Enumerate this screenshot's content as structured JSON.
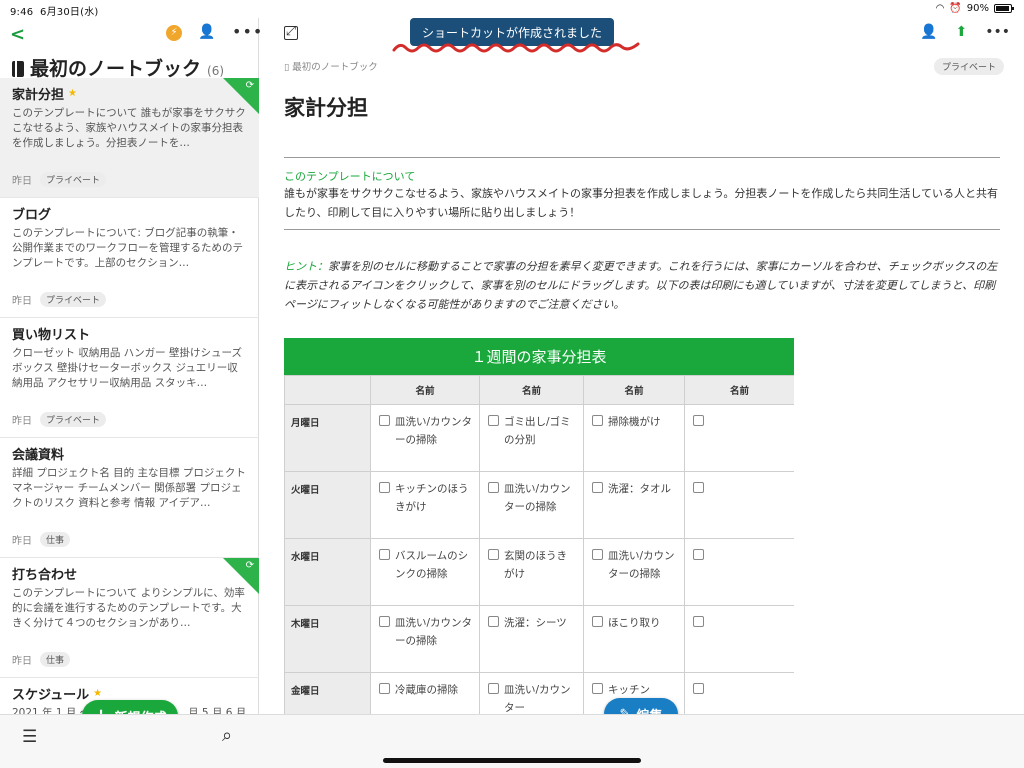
{
  "status_bar": {
    "time": "9:46",
    "date": "6月30日(水)",
    "battery": "90%"
  },
  "sidebar": {
    "notebook_title": "最初のノートブック",
    "notebook_count": "(6)",
    "notes": [
      {
        "title": "家計分担",
        "starred": true,
        "synced": true,
        "selected": true,
        "snippet": "このテンプレートについて 誰もが家事をサクサクこなせるよう、家族やハウスメイトの家事分担表を作成しましょう。分担表ノートを…",
        "date": "昨日",
        "tag": "プライベート"
      },
      {
        "title": "ブログ",
        "starred": false,
        "synced": false,
        "selected": false,
        "snippet": "このテンプレートについて: ブログ記事の執筆・公開作業までのワークフローを管理するためのテンプレートです。上部のセクション…",
        "date": "昨日",
        "tag": "プライベート"
      },
      {
        "title": "買い物リスト",
        "starred": false,
        "synced": false,
        "selected": false,
        "snippet": "クローゼット 収納用品 ハンガー 壁掛けシューズボックス 壁掛けセーターボックス ジュエリー収納用品 アクセサリー収納用品 スタッキ…",
        "date": "昨日",
        "tag": "プライベート"
      },
      {
        "title": "会議資料",
        "starred": false,
        "synced": false,
        "selected": false,
        "snippet": "詳細 プロジェクト名 目的 主な目標 プロジェクトマネージャー チームメンバー 関係部署 プロジェクトのリスク 資料と参考 情報 アイデア…",
        "date": "昨日",
        "tag": "仕事"
      },
      {
        "title": "打ち合わせ",
        "starred": false,
        "synced": true,
        "selected": false,
        "snippet": "このテンプレートについて よりシンプルに、効率的に会議を進行するためのテンプレートです。大きく分けて４つのセクションがあり…",
        "date": "昨日",
        "tag": "仕事"
      },
      {
        "title": "スケジュール",
        "starred": true,
        "synced": false,
        "selected": false,
        "snippet": "2021 年 1 月 〜　　　　　　　　　 月 5 月 6 月 1",
        "date": "",
        "tag": ""
      }
    ],
    "new_button": "新規作成"
  },
  "main": {
    "toast": "ショートカットが作成されました",
    "breadcrumb": "最初のノートブック",
    "privacy": "プライベート",
    "title": "家計分担",
    "about_heading": "このテンプレートについて",
    "about_body": "誰もが家事をサクサクこなせるよう、家族やハウスメイトの家事分担表を作成しましょう。分担表ノートを作成したら共同生活している人と共有したり、印刷して目に入りやすい場所に貼り出しましょう！",
    "hint_label": "ヒント：",
    "hint_body": "家事を別のセルに移動することで家事の分担を素早く変更できます。これを行うには、家事にカーソルを合わせ、チェックボックスの左に表示されるアイコンをクリックして、家事を別のセルにドラッグします。以下の表は印刷にも適していますが、寸法を変更してしまうと、印刷ページにフィットしなくなる可能性がありますのでご注意ください。",
    "table": {
      "title": "１週間の家事分担表",
      "headers": [
        "",
        "名前",
        "名前",
        "名前",
        "名前"
      ],
      "rows": [
        {
          "day": "月曜日",
          "cells": [
            "皿洗い/カウンターの掃除",
            "ゴミ出し/ゴミの分別",
            "掃除機がけ",
            ""
          ]
        },
        {
          "day": "火曜日",
          "cells": [
            "キッチンのほうきがけ",
            "皿洗い/カウンターの掃除",
            "洗濯：タオル",
            ""
          ]
        },
        {
          "day": "水曜日",
          "cells": [
            "バスルームのシンクの掃除",
            "玄関のほうきがけ",
            "皿洗い/カウンターの掃除",
            ""
          ]
        },
        {
          "day": "木曜日",
          "cells": [
            "皿洗い/カウンターの掃除",
            "洗濯：シーツ",
            "ほこり取り",
            ""
          ]
        },
        {
          "day": "金曜日",
          "cells": [
            "冷蔵庫の掃除",
            "皿洗い/カウンター",
            "キッチン",
            ""
          ]
        }
      ]
    },
    "edit_button": "編集"
  },
  "colors": {
    "accent_green": "#1aa83c",
    "toast_blue": "#1b4f7a",
    "edit_blue": "#1a7ec4",
    "star": "#f5b800"
  }
}
